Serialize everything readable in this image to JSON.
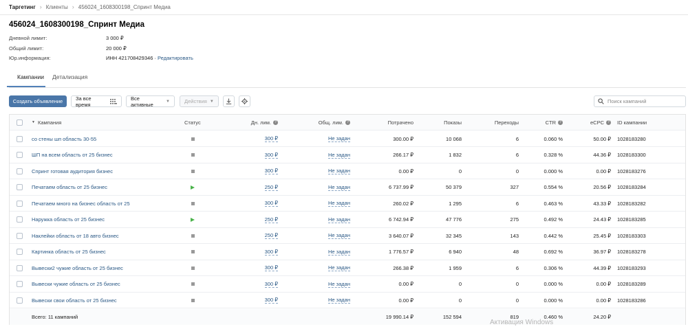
{
  "breadcrumb": [
    "Таргетинг",
    "Клиенты",
    "456024_1608300198_Спринт Медиа"
  ],
  "page_title": "456024_1608300198_Спринт Медиа",
  "info": {
    "daily_limit_label": "Дневной лимит:",
    "daily_limit_value": "3 000 ₽",
    "total_limit_label": "Общий лимит:",
    "total_limit_value": "20 000 ₽",
    "legal_label": "Юр.информация:",
    "legal_value": "ИНН 421708429346",
    "legal_sep": " · ",
    "legal_edit": "Редактировать"
  },
  "tabs": [
    {
      "label": "Кампании",
      "active": true
    },
    {
      "label": "Детализация",
      "active": false
    }
  ],
  "toolbar": {
    "create_label": "Создать объявление",
    "period_label": "За все время",
    "filter_label": "Все активные",
    "actions_label": "Действия",
    "search_placeholder": "Поиск кампаний"
  },
  "table": {
    "columns": {
      "campaign": "Кампания",
      "status": "Статус",
      "daily": "Дн. лим.",
      "total": "Общ. лим.",
      "spent": "Потрачено",
      "shows": "Показы",
      "clicks": "Переходы",
      "ctr": "CTR",
      "ecpc": "eCPC",
      "id": "ID кампании"
    },
    "rows": [
      {
        "name": "со стены шп область 30-55",
        "status": "stopped",
        "daily": "300 ₽",
        "total": "Не задан",
        "spent": "300.00 ₽",
        "shows": "10 068",
        "clicks": "6",
        "ctr": "0.060 %",
        "ecpc": "50.00 ₽",
        "id": "1028183280"
      },
      {
        "name": "ШП на всем область от 25 бизнес",
        "status": "stopped",
        "daily": "300 ₽",
        "total": "Не задан",
        "spent": "266.17 ₽",
        "shows": "1 832",
        "clicks": "6",
        "ctr": "0.328 %",
        "ecpc": "44.36 ₽",
        "id": "1028183300"
      },
      {
        "name": "Спринт готовая аудитория бизнес",
        "status": "stopped",
        "daily": "300 ₽",
        "total": "Не задан",
        "spent": "0.00 ₽",
        "shows": "0",
        "clicks": "0",
        "ctr": "0.000 %",
        "ecpc": "0.00 ₽",
        "id": "1028183276"
      },
      {
        "name": "Печатаем область от 25 бизнес",
        "status": "running",
        "daily": "250 ₽",
        "total": "Не задан",
        "spent": "6 737.99 ₽",
        "shows": "50 379",
        "clicks": "327",
        "ctr": "0.554 %",
        "ecpc": "20.56 ₽",
        "id": "1028183284"
      },
      {
        "name": "Печатаем много на бизнес область от 25",
        "status": "stopped",
        "daily": "300 ₽",
        "total": "Не задан",
        "spent": "260.02 ₽",
        "shows": "1 295",
        "clicks": "6",
        "ctr": "0.463 %",
        "ecpc": "43.33 ₽",
        "id": "1028183282"
      },
      {
        "name": "Наружка область от 25 бизнес",
        "status": "running",
        "daily": "250 ₽",
        "total": "Не задан",
        "spent": "6 742.94 ₽",
        "shows": "47 776",
        "clicks": "275",
        "ctr": "0.492 %",
        "ecpc": "24.43 ₽",
        "id": "1028183285"
      },
      {
        "name": "Наклейки область от 18 авто бизнес",
        "status": "stopped",
        "daily": "250 ₽",
        "total": "Не задан",
        "spent": "3 640.07 ₽",
        "shows": "32 345",
        "clicks": "143",
        "ctr": "0.442 %",
        "ecpc": "25.45 ₽",
        "id": "1028183303"
      },
      {
        "name": "Картинка область от 25 бизнес",
        "status": "stopped",
        "daily": "300 ₽",
        "total": "Не задан",
        "spent": "1 776.57 ₽",
        "shows": "6 940",
        "clicks": "48",
        "ctr": "0.692 %",
        "ecpc": "36.97 ₽",
        "id": "1028183278"
      },
      {
        "name": "Вывески2 чужие область от 25 бизнес",
        "status": "stopped",
        "daily": "300 ₽",
        "total": "Не задан",
        "spent": "266.38 ₽",
        "shows": "1 959",
        "clicks": "6",
        "ctr": "0.306 %",
        "ecpc": "44.39 ₽",
        "id": "1028183293"
      },
      {
        "name": "Вывески чужие область от 25 бизнес",
        "status": "stopped",
        "daily": "300 ₽",
        "total": "Не задан",
        "spent": "0.00 ₽",
        "shows": "0",
        "clicks": "0",
        "ctr": "0.000 %",
        "ecpc": "0.00 ₽",
        "id": "1028183289"
      },
      {
        "name": "Вывески свои область от 25 бизнес",
        "status": "stopped",
        "daily": "300 ₽",
        "total": "Не задан",
        "spent": "0.00 ₽",
        "shows": "0",
        "clicks": "0",
        "ctr": "0.000 %",
        "ecpc": "0.00 ₽",
        "id": "1028183286"
      }
    ],
    "footer": {
      "label": "Всего: 11 кампаний",
      "spent": "19 990.14 ₽",
      "shows": "152 594",
      "clicks": "819",
      "ctr": "0.460 %",
      "ecpc": "24.20 ₽"
    }
  },
  "watermark": "Активация Windows",
  "colors": {
    "primary": "#4a76a8",
    "link": "#2a5885",
    "running": "#4bb34b",
    "stopped": "#999999"
  }
}
